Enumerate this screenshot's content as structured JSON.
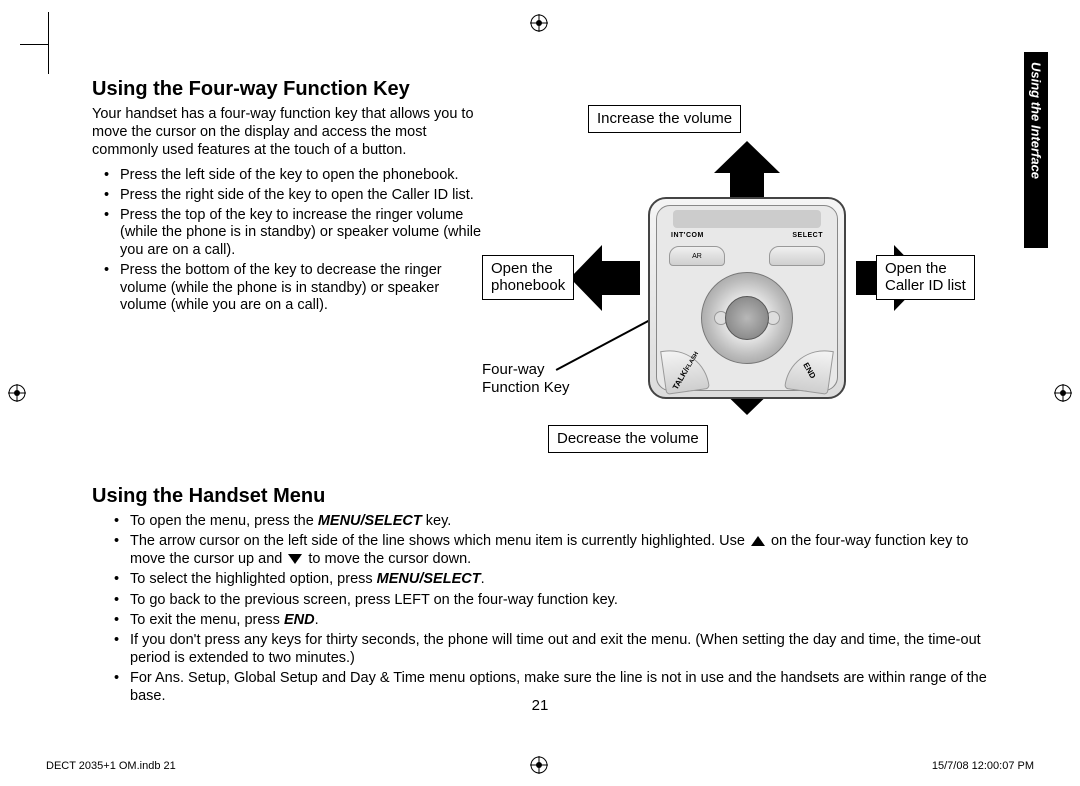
{
  "side_tab": "Using the Interface",
  "section1": {
    "title": "Using the Four-way Function Key",
    "intro": "Your handset has a four-way function key that allows you to move the cursor on the display and access the most commonly used features at the touch of a button.",
    "bullets": [
      "Press the left side of the key to open the phonebook.",
      "Press the right side of the key to open the Caller ID list.",
      "Press the top of the key to increase the ringer volume (while the phone is in standby) or speaker volume (while you are on a call).",
      "Press the bottom of the key to decrease the ringer volume (while the phone is in standby) or speaker volume (while you are on a call)."
    ]
  },
  "diagram": {
    "callout_up": "Increase the volume",
    "callout_left_l1": "Open the",
    "callout_left_l2": "phonebook",
    "callout_right_l1": "Open the",
    "callout_right_l2": "Caller ID list",
    "callout_down": "Decrease the volume",
    "callout_center_l1": "Four-way",
    "callout_center_l2": "Function Key",
    "phone_soft_left": "INT'COM",
    "phone_soft_right": "SELECT",
    "phone_btn_talk": "TALK",
    "phone_btn_end": "END",
    "phone_btn_flash": "FLASH",
    "phone_btn_ar": "AR"
  },
  "section2": {
    "title": "Using the Handset Menu",
    "b1_pre": "To open the menu, press the ",
    "b1_key": "MENU/SELECT",
    "b1_post": " key.",
    "b2_pre": "The arrow cursor on the left side of the line shows which menu item is currently highlighted. Use ",
    "b2_mid": " on the four-way function key to move the cursor up and ",
    "b2_post": " to move the cursor down.",
    "b3_pre": "To select the highlighted option, press ",
    "b3_key": "MENU/SELECT",
    "b3_post": ".",
    "b4": "To go back to the previous screen, press LEFT on the four-way function key.",
    "b5_pre": "To exit the menu, press ",
    "b5_key": "END",
    "b5_post": ".",
    "b6": "If you don't press any keys for thirty seconds, the phone will time out and exit the menu. (When setting the day and time, the time-out period is extended to two minutes.)",
    "b7": "For Ans. Setup, Global Setup and Day & Time menu options, make sure the line is not in use and the handsets are within range of the base."
  },
  "page_number": "21",
  "footer_left": "DECT 2035+1 OM.indb   21",
  "footer_right": "15/7/08   12:00:07 PM"
}
